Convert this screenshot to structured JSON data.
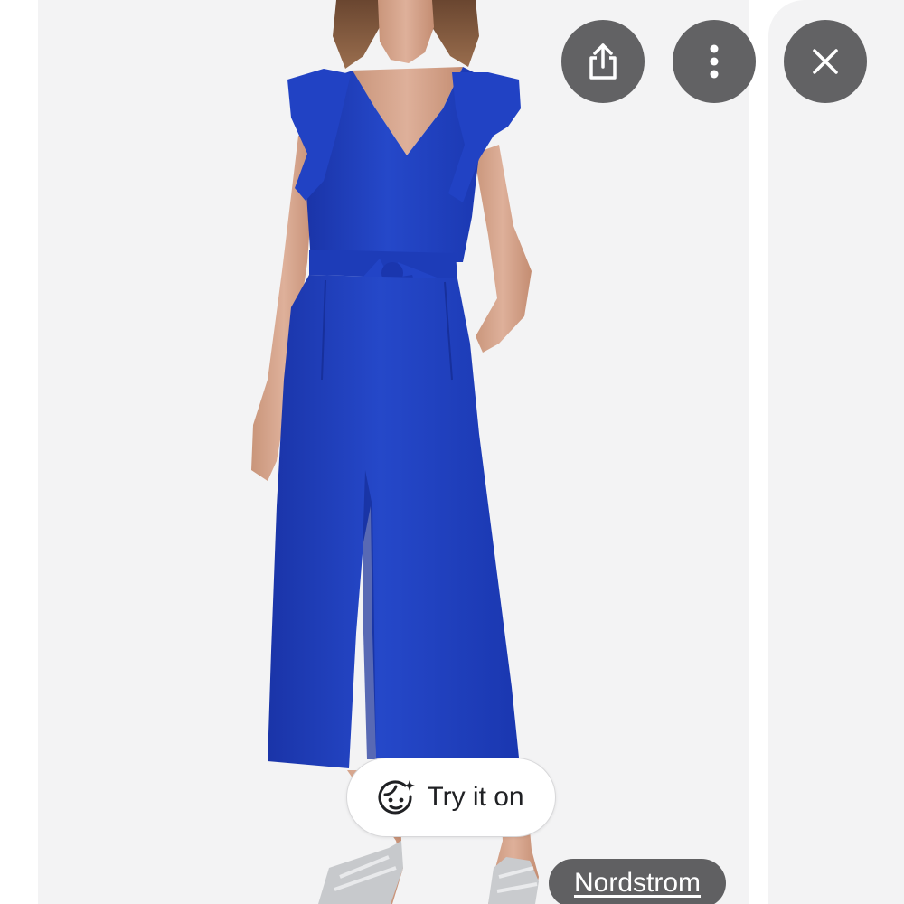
{
  "actions": {
    "share_icon": "share-icon",
    "more_icon": "more-vertical-icon",
    "close_icon": "close-icon"
  },
  "try_on": {
    "label": "Try it on",
    "icon": "face-sparkle-icon"
  },
  "source": {
    "label": "Nordstrom"
  },
  "colors": {
    "background_card": "#f3f3f4",
    "button_gray": "#626264",
    "garment_blue": "#1f3fbf"
  }
}
